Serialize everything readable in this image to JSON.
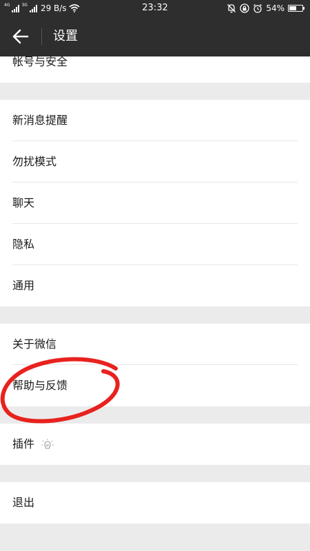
{
  "status_bar": {
    "net_label_1": "4G",
    "net_label_2": "3G",
    "speed": "29 B/s",
    "time": "23:32",
    "battery": "54%",
    "battery_level": 0.54
  },
  "header": {
    "title": "设置",
    "back_icon": "arrow-left-icon"
  },
  "groups": [
    {
      "items": [
        {
          "label": "帐号与安全"
        }
      ]
    },
    {
      "items": [
        {
          "label": "新消息提醒"
        },
        {
          "label": "勿扰模式"
        },
        {
          "label": "聊天"
        },
        {
          "label": "隐私"
        },
        {
          "label": "通用"
        }
      ]
    },
    {
      "items": [
        {
          "label": "关于微信"
        },
        {
          "label": "帮助与反馈"
        }
      ]
    },
    {
      "items": [
        {
          "label": "插件",
          "icon": "bulb-icon"
        }
      ]
    },
    {
      "items": [
        {
          "label": "退出"
        }
      ]
    }
  ],
  "annotation": {
    "shape": "hand-drawn-ellipse",
    "color": "#e8221e",
    "target": "帮助与反馈"
  },
  "colors": {
    "header_bg": "#2e2e2e",
    "page_bg": "#ebebeb",
    "item_bg": "#ffffff",
    "accent_annotation": "#e8221e"
  }
}
